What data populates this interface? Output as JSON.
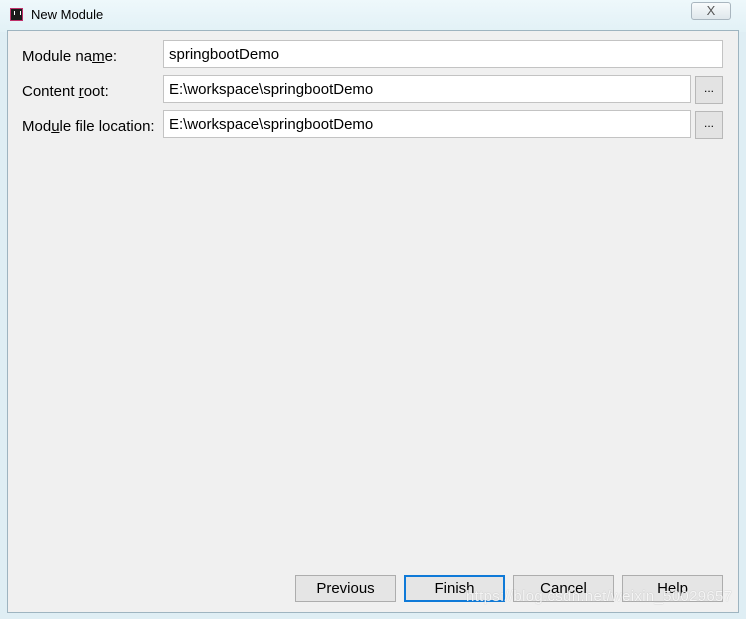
{
  "window": {
    "title": "New Module",
    "icon": "intellij-icon",
    "close_label": "X"
  },
  "form": {
    "module_name": {
      "label_pre": "Module na",
      "label_mnemonic": "m",
      "label_post": "e:",
      "value": "springbootDemo"
    },
    "content_root": {
      "label_pre": "Content ",
      "label_mnemonic": "r",
      "label_post": "oot:",
      "value": "E:\\workspace\\springbootDemo",
      "browse_label": "..."
    },
    "module_file_location": {
      "label_pre": "Mod",
      "label_mnemonic": "u",
      "label_post": "le file location:",
      "value": "E:\\workspace\\springbootDemo",
      "browse_label": "..."
    }
  },
  "buttons": {
    "previous": "Previous",
    "finish": "Finish",
    "cancel": "Cancel",
    "help": "Help"
  },
  "watermark": "https://blog.csdn.net/weixin_50029657",
  "colors": {
    "accent": "#0f7ad8",
    "panel": "#f0f0f0"
  }
}
